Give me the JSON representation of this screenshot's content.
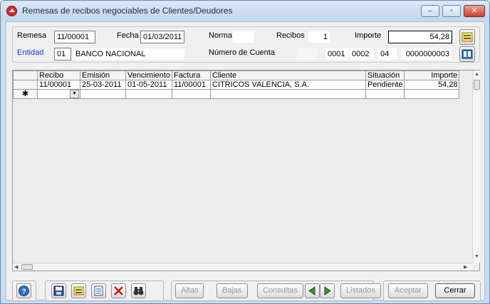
{
  "window": {
    "title": "Remesas de recibos negociables de Clientes/Deudores",
    "controls": {
      "minimize": "–",
      "maximize": "▫",
      "close": "✕"
    }
  },
  "header": {
    "remesa_label": "Remesa",
    "remesa_value": "11/00001",
    "fecha_label": "Fecha",
    "fecha_value": "01/03/2011",
    "norma_label": "Norma",
    "norma_value": "",
    "recibos_label": "Recibos",
    "recibos_value": "1",
    "importe_label": "Importe",
    "importe_value": "54,28",
    "entidad_label": "Entidad",
    "entidad_code": "01",
    "entidad_name": "BANCO NACIONAL",
    "cuenta_label": "Número de Cuenta",
    "cuenta_part0": "",
    "cuenta_part1": "0001",
    "cuenta_part2": "0002",
    "cuenta_part3": "04",
    "cuenta_part4": "0000000003"
  },
  "grid": {
    "columns": [
      "Recibo",
      "Emisión",
      "Vencimiento",
      "Factura",
      "Cliente",
      "Situación",
      "Importe"
    ],
    "rows": [
      {
        "recibo": "11/00001",
        "emision": "25-03-2011",
        "vencimiento": "01-05-2011",
        "factura": "11/00001",
        "cliente": "CITRICOS VALENCIA, S.A.",
        "situacion": "Pendiente",
        "importe": "54,28"
      }
    ],
    "new_row_marker": "✱"
  },
  "toolbar": {
    "altas": "Altas",
    "bajas": "Bajas",
    "consultas": "Consultas",
    "listados": "Listados",
    "aceptar": "Aceptar",
    "cerrar": "Cerrar"
  },
  "icons": {
    "help": "help-icon",
    "save": "save-icon",
    "edit": "edit-icon",
    "document": "document-icon",
    "delete": "delete-icon",
    "search": "binoculars-icon",
    "prev": "arrow-left-icon",
    "next": "arrow-right-icon"
  },
  "colors": {
    "accent_blue": "#0a3ecc",
    "close_red": "#c9412a",
    "delete_red": "#d01818",
    "nav_green": "#2f9a2f"
  }
}
